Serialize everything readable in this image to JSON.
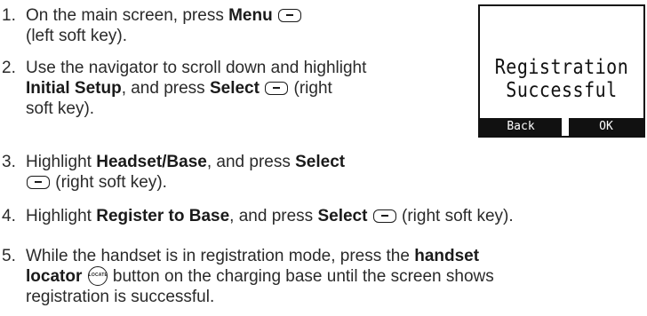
{
  "steps": [
    {
      "number": "1.",
      "lines": [
        [
          "On the main screen, press ",
          "Menu",
          ""
        ],
        [
          "(left soft key)."
        ]
      ]
    },
    {
      "number": "2.",
      "line1": "Use the navigator to scroll down and highlight",
      "bold1": "Initial Setup",
      "text1": ", and press ",
      "bold2": "Select",
      "text2": " (right",
      "line3": "soft key)."
    },
    {
      "number": "3.",
      "text1": "Highlight ",
      "bold1": "Headset/Base",
      "text2": ", and press ",
      "bold2": "Select",
      "line2": " (right soft key)."
    },
    {
      "number": "4.",
      "text1": "Highlight ",
      "bold1": "Register to Base",
      "text2": ", and press ",
      "bold2": "Select",
      "text3": " (right soft key)."
    },
    {
      "number": "5.",
      "line1": "While the handset is in registration mode, press the ",
      "bold1": "handset",
      "bold2": "locator",
      "icon_text": "LOCATE",
      "text2": " button on the charging base until the screen shows",
      "line3": "registration is successful."
    }
  ],
  "step1": {
    "number": "1.",
    "text1": "On the main screen, press ",
    "bold1": "Menu",
    "line2": "(left soft key)."
  },
  "screen": {
    "message_line1": "Registration",
    "message_line2": "Successful",
    "left_softkey": "Back",
    "right_softkey": "OK"
  },
  "icons": {
    "softkey": "soft-key-icon",
    "locator": "locate-button-icon"
  }
}
